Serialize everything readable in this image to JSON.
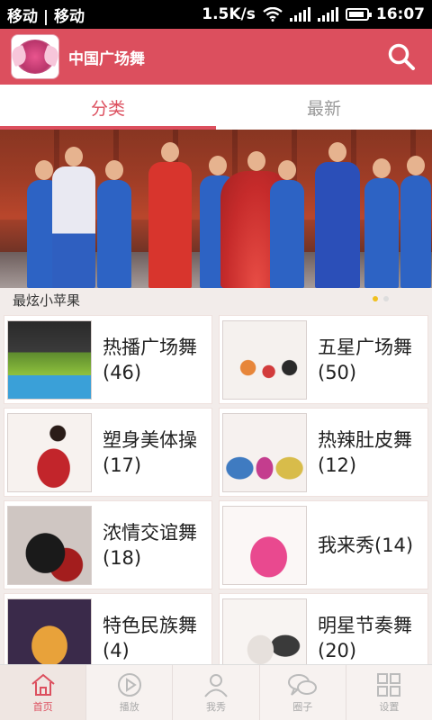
{
  "status": {
    "carrier": "移动 | 移动",
    "speed": "1.5K/s",
    "time": "16:07"
  },
  "header": {
    "title": "中国广场舞",
    "logo_icon": "winged-dancer-logo",
    "search_icon": "search-icon"
  },
  "tabs": [
    {
      "label": "分类",
      "active": true
    },
    {
      "label": "最新",
      "active": false
    }
  ],
  "banner": {
    "caption": "最炫小苹果",
    "page_count": 2,
    "current_page": 1
  },
  "categories": [
    {
      "label": "热播广场舞(46)"
    },
    {
      "label": "五星广场舞(50)"
    },
    {
      "label": "塑身美体操(17)"
    },
    {
      "label": "热辣肚皮舞(12)"
    },
    {
      "label": "浓情交谊舞(18)"
    },
    {
      "label": "我来秀(14)"
    },
    {
      "label": "特色民族舞(4)"
    },
    {
      "label": "明星节奏舞(20)"
    }
  ],
  "bottom_nav": [
    {
      "label": "首页",
      "icon": "home-icon",
      "active": true
    },
    {
      "label": "播放",
      "icon": "play-icon",
      "active": false
    },
    {
      "label": "我秀",
      "icon": "person-icon",
      "active": false
    },
    {
      "label": "圈子",
      "icon": "chat-bubbles-icon",
      "active": false
    },
    {
      "label": "设置",
      "icon": "grid-icon",
      "active": false
    }
  ],
  "colors": {
    "accent": "#dc4f5e",
    "background": "#f2ecea"
  }
}
